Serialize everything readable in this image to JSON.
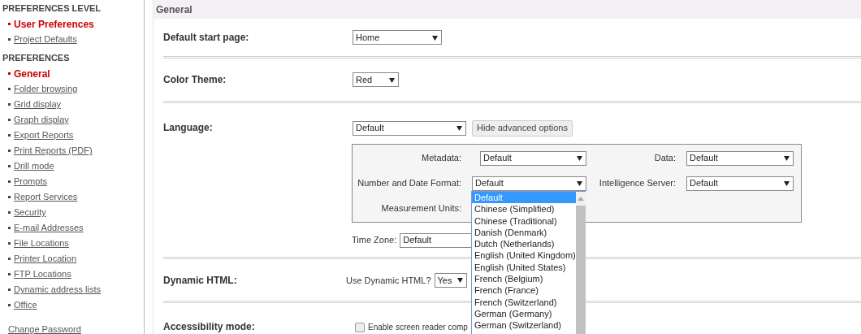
{
  "sidebar": {
    "sections": [
      {
        "heading": "PREFERENCES LEVEL",
        "items": [
          {
            "label": "User Preferences",
            "selected": true
          },
          {
            "label": "Project Defaults",
            "selected": false
          }
        ]
      },
      {
        "heading": "PREFERENCES",
        "items": [
          {
            "label": "General",
            "selected": true
          },
          {
            "label": "Folder browsing",
            "selected": false
          },
          {
            "label": "Grid display",
            "selected": false
          },
          {
            "label": "Graph display",
            "selected": false
          },
          {
            "label": "Export Reports",
            "selected": false
          },
          {
            "label": "Print Reports (PDF)",
            "selected": false
          },
          {
            "label": "Drill mode",
            "selected": false
          },
          {
            "label": "Prompts",
            "selected": false
          },
          {
            "label": "Report Services",
            "selected": false
          },
          {
            "label": "Security",
            "selected": false
          },
          {
            "label": "E-mail Addresses",
            "selected": false
          },
          {
            "label": "File Locations",
            "selected": false
          },
          {
            "label": "Printer Location",
            "selected": false
          },
          {
            "label": "FTP Locations",
            "selected": false
          },
          {
            "label": "Dynamic address lists",
            "selected": false
          },
          {
            "label": "Office",
            "selected": false
          }
        ]
      }
    ],
    "footer_link": "Change Password"
  },
  "main": {
    "title": "General",
    "start_page": {
      "label": "Default start page:",
      "value": "Home"
    },
    "color_theme": {
      "label": "Color Theme:",
      "value": "Red"
    },
    "language": {
      "label": "Language:",
      "value": "Default",
      "button": "Hide advanced options",
      "advanced": {
        "metadata": {
          "label": "Metadata:",
          "value": "Default"
        },
        "data": {
          "label": "Data:",
          "value": "Default"
        },
        "number_format": {
          "label": "Number and Date Format:",
          "value": "Default"
        },
        "intelligence_server": {
          "label": "Intelligence Server:",
          "value": "Default"
        },
        "measurement_units": {
          "label": "Measurement Units:"
        }
      },
      "time_zone": {
        "label": "Time Zone:",
        "value": "Default"
      }
    },
    "dynamic_html": {
      "label": "Dynamic HTML:",
      "question": "Use Dynamic HTML?",
      "value": "Yes"
    },
    "accessibility": {
      "label": "Accessibility mode:",
      "checkbox": {
        "label": "Enable screen reader comp",
        "checked": false
      }
    }
  },
  "dropdown": {
    "options": [
      {
        "label": "Default",
        "selected": true
      },
      {
        "label": "Chinese (Simplified)",
        "selected": false
      },
      {
        "label": "Chinese (Traditional)",
        "selected": false
      },
      {
        "label": "Danish (Denmark)",
        "selected": false
      },
      {
        "label": "Dutch (Netherlands)",
        "selected": false
      },
      {
        "label": "English (United Kingdom)",
        "selected": false
      },
      {
        "label": "English (United States)",
        "selected": false
      },
      {
        "label": "French (Belgium)",
        "selected": false
      },
      {
        "label": "French (France)",
        "selected": false
      },
      {
        "label": "French (Switzerland)",
        "selected": false
      },
      {
        "label": "German (Germany)",
        "selected": false
      },
      {
        "label": "German (Switzerland)",
        "selected": false
      }
    ]
  }
}
